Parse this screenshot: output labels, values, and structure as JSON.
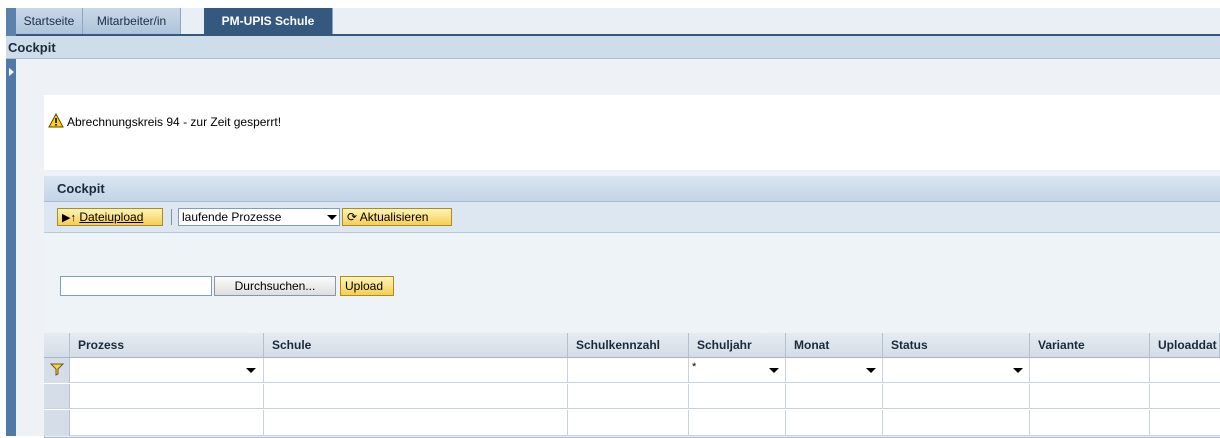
{
  "tabs": [
    {
      "label": "Startseite",
      "active": false
    },
    {
      "label": "Mitarbeiter/in",
      "active": false
    },
    {
      "label": "PM-UPIS Schule",
      "active": true
    }
  ],
  "page_title": "Cockpit",
  "message": {
    "icon": "warning-icon",
    "text": "Abrechnungskreis 94 - zur Zeit gesperrt!"
  },
  "tray": {
    "title": "Cockpit",
    "toolbar": {
      "upload_button": "Dateiupload",
      "process_select": "laufende Prozesse",
      "refresh_button": "Aktualisieren"
    },
    "file_upload": {
      "value": "",
      "browse_button": "Durchsuchen...",
      "upload_button": "Upload"
    }
  },
  "table": {
    "columns": [
      "Prozess",
      "Schule",
      "Schulkennzahl",
      "Schuljahr",
      "Monat",
      "Status",
      "Variante",
      "Uploaddat"
    ],
    "filter_row": {
      "Schuljahr": "*"
    },
    "rows": [
      [],
      []
    ]
  },
  "colors": {
    "accent": "#35587e",
    "button_yellow": "#f4cf53",
    "nav": "#4f79a7"
  }
}
